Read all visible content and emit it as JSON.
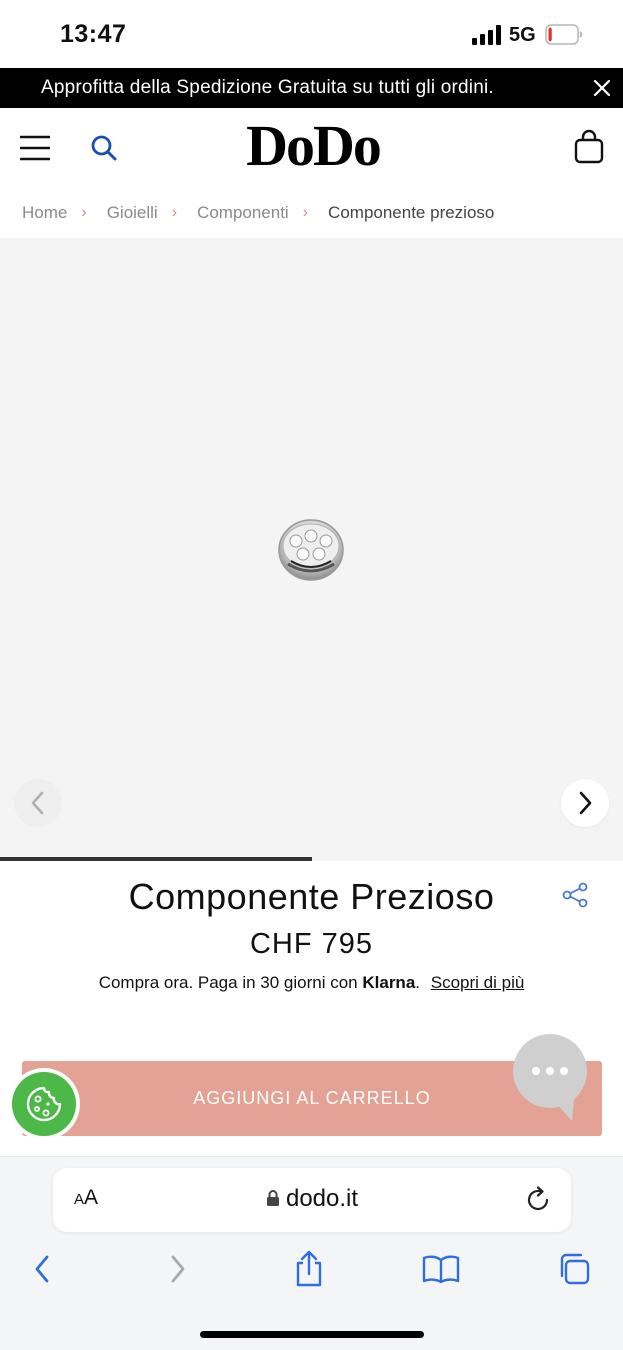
{
  "status_bar": {
    "time": "13:47",
    "network": "5G",
    "battery_level": 0.12,
    "battery_color": "#e0302a"
  },
  "promo": {
    "text": "Approfitta della Spedizione Gratuita su tutti gli ordini."
  },
  "header": {
    "logo": "DoDo",
    "menu_icon": "hamburger-menu-icon",
    "search_icon": "search-icon",
    "bag_icon": "shopping-bag-icon"
  },
  "breadcrumb": {
    "items": [
      "Home",
      "Gioielli",
      "Componenti"
    ],
    "current": "Componente prezioso"
  },
  "gallery": {
    "progress": 0.5,
    "product_image": "silver-diamond-bead-charm"
  },
  "product": {
    "title": "Componente Prezioso",
    "price": "CHF 795",
    "klarna_prefix": "Compra ora. Paga in 30 giorni con",
    "klarna_brand": "Klarna",
    "klarna_suffix": ".",
    "klarna_link": "Scopri di più"
  },
  "actions": {
    "add_to_cart": "AGGIUNGI AL CARRELLO"
  },
  "colors": {
    "accent": "#e4a294",
    "breadcrumb_separator": "#c98d82",
    "cookie_green": "#4cb848",
    "browser_blue": "#2f6fdb"
  },
  "browser": {
    "text_size_label": "AA",
    "url": "dodo.it"
  }
}
